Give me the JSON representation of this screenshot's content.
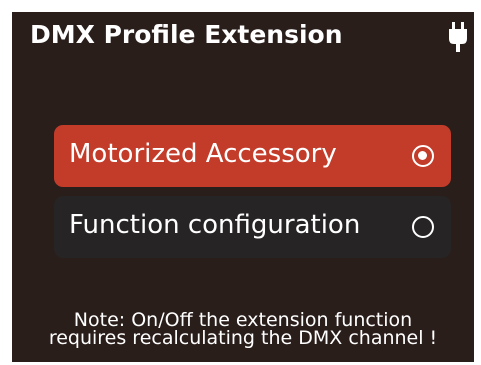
{
  "header": {
    "title": "DMX Profile Extension",
    "status_icon": "power-plug-icon"
  },
  "options": [
    {
      "label": "Motorized Accessory",
      "selected": true
    },
    {
      "label": "Function configuration",
      "selected": false
    }
  ],
  "note": {
    "line1": "Note: On/Off the extension function",
    "line2": "requires recalculating the DMX channel !"
  },
  "colors": {
    "background": "#2a1e1b",
    "selected_option": "#c33c2a",
    "unselected_option": "#262424",
    "text": "#ffffff"
  }
}
